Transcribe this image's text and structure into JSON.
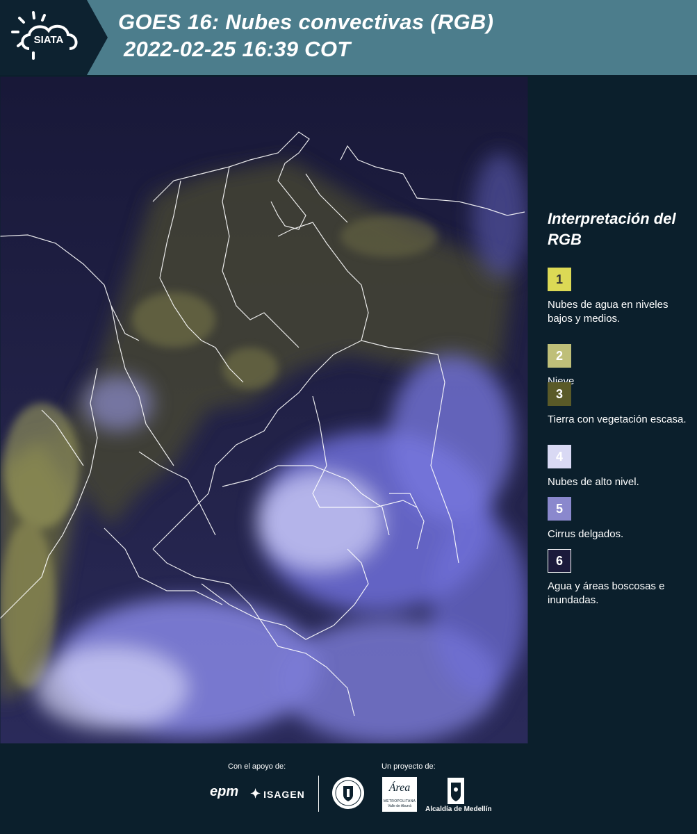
{
  "header": {
    "logo_text": "SIATA",
    "title_line1": "GOES 16: Nubes convectivas (RGB)",
    "title_line2": "2022-02-25 16:39 COT"
  },
  "map": {
    "icon": "satellite-rgb-image"
  },
  "legend": {
    "title": "Interpretación del RGB",
    "items": [
      {
        "number": "1",
        "label": "Nubes de agua en niveles bajos y medios.",
        "color": "#dcd955",
        "text_color": "#333333"
      },
      {
        "number": "2",
        "label": "Nieve",
        "color": "#bfbf79",
        "text_color": "#ffffff"
      },
      {
        "number": "3",
        "label": "Tierra con vegetación escasa.",
        "color": "#5a5a28",
        "text_color": "#ffffff"
      },
      {
        "number": "4",
        "label": "Nubes de alto nivel.",
        "color": "#d9d9f4",
        "text_color": "#ffffff"
      },
      {
        "number": "5",
        "label": "Cirrus delgados.",
        "color": "#8a88cd",
        "text_color": "#ffffff"
      },
      {
        "number": "6",
        "label": "Agua y áreas boscosas e inundadas.",
        "color": "#1b1a3b",
        "text_color": "#ffffff"
      }
    ]
  },
  "footer": {
    "support_label": "Con el apoyo de:",
    "project_label": "Un proyecto de:",
    "epm": "epm",
    "isagen": "ISAGEN",
    "area_name": "Área",
    "area_sub1": "METROPOLITANA",
    "area_sub2": "Valle de Aburrá",
    "alcaldia": "Alcaldía de Medellín"
  }
}
